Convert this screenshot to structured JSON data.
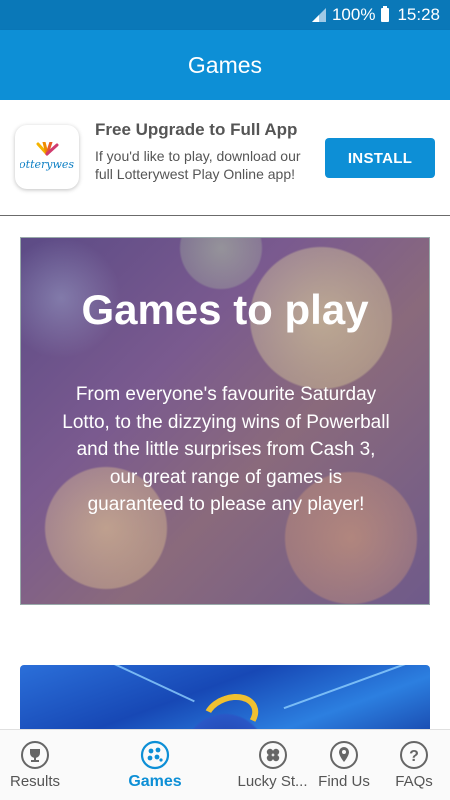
{
  "status_bar": {
    "battery": "100%",
    "time": "15:28"
  },
  "app_bar": {
    "title": "Games"
  },
  "promo": {
    "logo_text": "lotterywest",
    "title": "Free Upgrade to Full App",
    "description": "If you'd like to play, download our full Lotterywest Play Online app!",
    "install_label": "INSTALL"
  },
  "hero": {
    "title": "Games to play",
    "text": "From everyone's favourite Saturday Lotto, to the dizzying wins of Powerball and the little surprises from Cash 3, our great range of games is guaranteed to please any player!"
  },
  "bottom_nav": {
    "items": [
      {
        "label": "Results",
        "icon": "trophy-icon"
      },
      {
        "label": "Games",
        "icon": "lottery-balls-icon",
        "active": true
      },
      {
        "label": "Lucky St...",
        "icon": "clover-icon"
      },
      {
        "label": "Find Us",
        "icon": "map-pin-icon"
      },
      {
        "label": "FAQs",
        "icon": "help-icon"
      }
    ]
  },
  "colors": {
    "status_bar": "#0a78b8",
    "app_bar": "#0d8fd6",
    "accent": "#0d8fd6"
  }
}
